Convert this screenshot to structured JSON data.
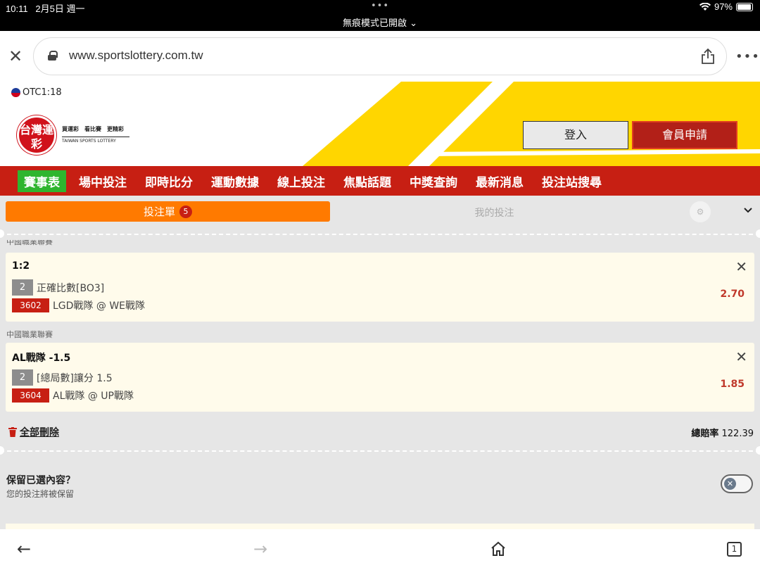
{
  "status_bar": {
    "time": "10:11",
    "date": "2月5日 週一",
    "privacy_mode": "無痕模式已開啟",
    "battery": "97%"
  },
  "browser": {
    "url": "www.sportslottery.com.tw"
  },
  "site": {
    "flag_text": "OTC1:18",
    "logo_main": "台灣運彩",
    "logo_slogan": "買運彩　看比賽　更精彩",
    "logo_en": "TAIWAN SPORTS LOTTERY",
    "login_label": "登入",
    "register_label": "會員申請"
  },
  "nav": {
    "items": [
      "賽事表",
      "場中投注",
      "即時比分",
      "運動數據",
      "線上投注",
      "焦點話題",
      "中獎查詢",
      "最新消息",
      "投注站搜尋"
    ]
  },
  "tabs": {
    "slip_label": "投注單",
    "slip_count": "5",
    "mybets_label": "我的投注"
  },
  "bets": [
    {
      "league": "中國職業聯賽",
      "title": "1:2",
      "num": "2",
      "market": "正確比數[BO3]",
      "code": "3602",
      "match": "LGD戰隊 @ WE戰隊",
      "odds": "2.70"
    },
    {
      "league": "中國職業聯賽",
      "title": "AL戰隊 -1.5",
      "num": "2",
      "market": "[總局數]讓分 1.5",
      "code": "3604",
      "match": "AL戰隊 @ UP戰隊",
      "odds": "1.85"
    }
  ],
  "footer": {
    "delete_all": "全部刪除",
    "total_odds_label": "總賠率",
    "total_odds_value": "122.39",
    "keep_title": "保留已選內容？",
    "keep_sub": "您的投注將被保留"
  },
  "toolbar": {
    "tabs_count": "1"
  },
  "colors": {
    "nav_red": "#c71f13",
    "accent_orange": "#ff7a00",
    "active_green": "#2fb52f",
    "brand_yellow": "#ffd600",
    "odds_red": "#c0392b"
  }
}
